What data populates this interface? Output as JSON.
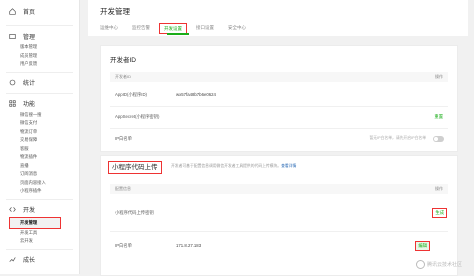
{
  "sidebar": {
    "home": "首页",
    "groups": [
      {
        "label": "管理",
        "icon": "folder-icon",
        "items": [
          "版本管理",
          "成员管理",
          "用户反馈"
        ]
      },
      {
        "label": "统计",
        "icon": "chart-icon",
        "items": []
      },
      {
        "label": "功能",
        "icon": "grid-icon",
        "items": [
          "微信搜一搜",
          "微信支付",
          "物流订单",
          "交易保障",
          "客服",
          "物流插件",
          "直播",
          "订阅消息",
          "页面内容接入",
          "小程序插件"
        ]
      },
      {
        "label": "开发",
        "icon": "code-icon",
        "items": [
          "开发管理",
          "开发工具",
          "云开发"
        ]
      },
      {
        "label": "成长",
        "icon": "growth-icon",
        "items": []
      }
    ],
    "active_item": "开发管理"
  },
  "header": {
    "title": "开发管理",
    "tabs": [
      "运维中心",
      "监控告警",
      "开发设置",
      "接口设置",
      "安全中心"
    ],
    "active_tab": "开发设置"
  },
  "developer_card": {
    "title": "开发者ID",
    "col_left": "开发者ID",
    "col_right": "操作",
    "rows": [
      {
        "label": "AppID(小程序ID)",
        "value": "wx57fa48b7b6e0624",
        "action": ""
      },
      {
        "label": "AppSecret(小程序密钥)",
        "value": "",
        "action": "重置"
      },
      {
        "label": "IP白名单",
        "value": "",
        "hint": "暂无IP白名单，请先开启IP白名单",
        "action": ""
      }
    ]
  },
  "upload_card": {
    "title": "小程序代码上传",
    "desc": "开发者可基于配置信息调用微信开发者工具提供的代码上传模块。",
    "desc_link": "查看详情",
    "col_left": "配置信息",
    "col_right": "操作",
    "rows": [
      {
        "label": "小程序代码上传密钥",
        "value": "",
        "action": "生成"
      },
      {
        "label": "IP白名单",
        "value": "171.8.27.183",
        "action": "编辑"
      }
    ]
  },
  "watermark": "腾讯云技术社区"
}
